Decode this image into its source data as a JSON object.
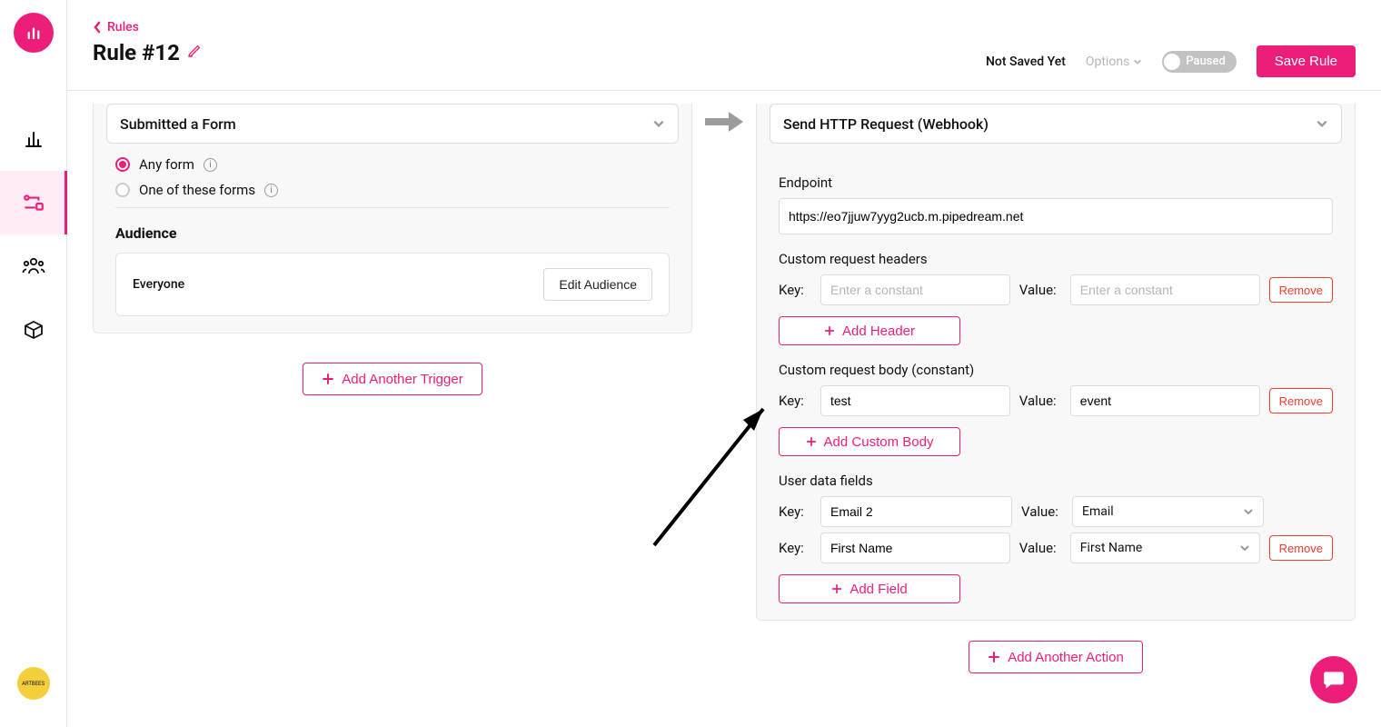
{
  "breadcrumb": {
    "back_label": "Rules"
  },
  "page": {
    "title": "Rule #12"
  },
  "header": {
    "not_saved": "Not Saved Yet",
    "options": "Options",
    "toggle_label": "Paused",
    "save_btn": "Save Rule"
  },
  "trigger": {
    "selector_label": "Submitted a Form",
    "radio_any": "Any form",
    "radio_one": "One of these forms",
    "audience_heading": "Audience",
    "audience_value": "Everyone",
    "edit_audience_btn": "Edit Audience",
    "add_trigger_btn": "Add Another Trigger"
  },
  "action": {
    "selector_label": "Send HTTP Request (Webhook)",
    "endpoint_label": "Endpoint",
    "endpoint_value": "https://eo7jjuw7yyg2ucb.m.pipedream.net",
    "headers_label": "Custom request headers",
    "key_label": "Key:",
    "value_label": "Value:",
    "placeholder_constant": "Enter a constant",
    "remove_btn": "Remove",
    "add_header_btn": "Add Header",
    "body_label": "Custom request body (constant)",
    "body_key": "test",
    "body_value": "event",
    "add_body_btn": "Add Custom Body",
    "user_fields_label": "User data fields",
    "uf1_key": "Email 2",
    "uf1_val": "Email",
    "uf2_key": "First Name",
    "uf2_val": "First Name",
    "add_field_btn": "Add Field",
    "add_action_btn": "Add Another Action"
  },
  "artbees_label": "ARTBEES"
}
